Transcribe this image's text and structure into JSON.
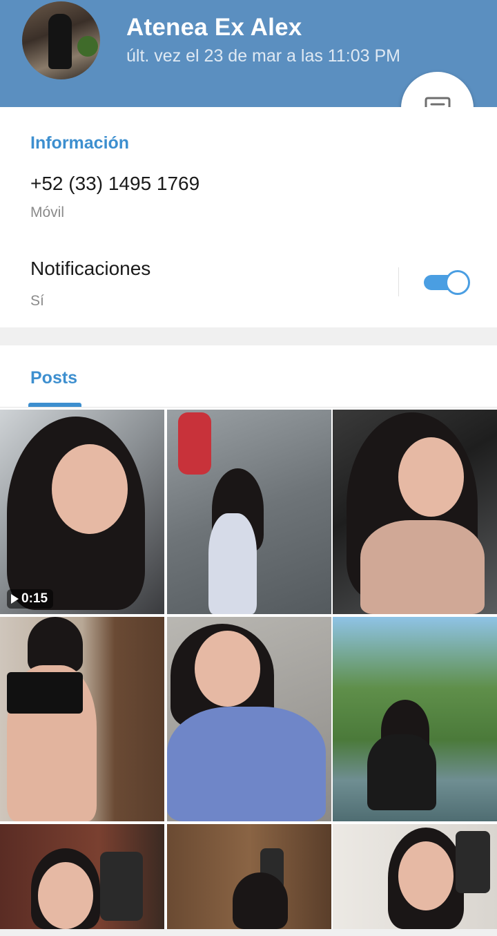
{
  "header": {
    "name": "Atenea Ex Alex",
    "status": "últ. vez el 23 de mar a las 11:03 PM",
    "background": "#5b8fc0",
    "message_button_icon": "chat-bubble-icon"
  },
  "info": {
    "section_title": "Información",
    "phone": "+52 (33) 1495 1769",
    "phone_label": "Móvil",
    "notifications_label": "Notificaciones",
    "notifications_value": "Sí",
    "notifications_enabled": true,
    "accent": "#3d8fcf"
  },
  "posts": {
    "tab_label": "Posts",
    "items": [
      {
        "kind": "video",
        "duration": "0:15"
      },
      {
        "kind": "photo"
      },
      {
        "kind": "photo"
      },
      {
        "kind": "photo"
      },
      {
        "kind": "photo"
      },
      {
        "kind": "photo"
      },
      {
        "kind": "photo"
      },
      {
        "kind": "photo"
      },
      {
        "kind": "photo"
      }
    ]
  }
}
